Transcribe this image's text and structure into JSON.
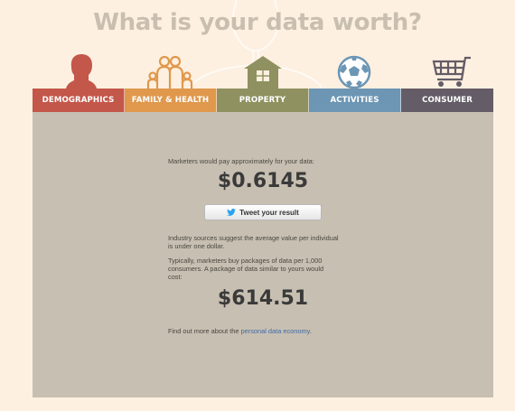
{
  "header": {
    "title": "What is your data worth?"
  },
  "tabs": [
    {
      "label": "DEMOGRAPHICS",
      "icon": "head-icon",
      "color": "#c3574a"
    },
    {
      "label": "FAMILY & HEALTH",
      "icon": "family-icon",
      "color": "#e0984c"
    },
    {
      "label": "PROPERTY",
      "icon": "house-icon",
      "color": "#8f9160"
    },
    {
      "label": "ACTIVITIES",
      "icon": "soccer-ball-icon",
      "color": "#6c96b4"
    },
    {
      "label": "CONSUMER",
      "icon": "shopping-cart-icon",
      "color": "#645c66"
    }
  ],
  "result": {
    "intro": "Marketers would pay approximately for your data:",
    "value": "$0.6145",
    "tweet_label": "Tweet your result",
    "industry_line1": "Industry sources suggest the average value per individual",
    "industry_line2": "is under one dollar.",
    "package_line1": "Typically, marketers buy packages of data per 1,000",
    "package_line2": "consumers. A package of data similar to yours would",
    "package_line3": "cost:",
    "package_value": "$614.51",
    "more_prefix": "Find out more about the ",
    "more_link": "personal data economy",
    "more_suffix": "."
  }
}
